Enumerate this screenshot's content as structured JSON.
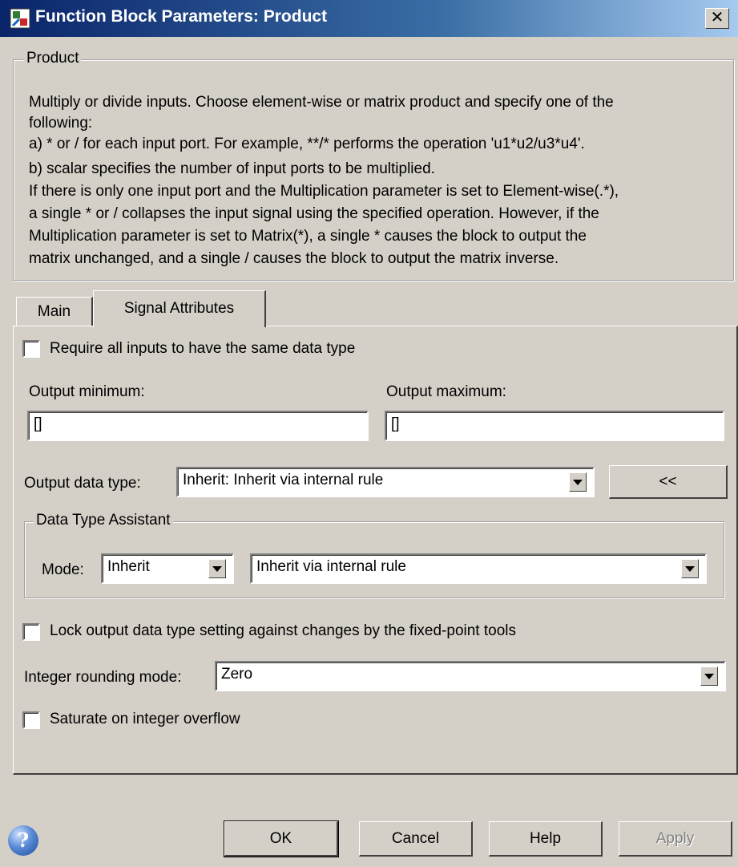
{
  "window": {
    "title": "Function Block Parameters: Product",
    "close_label": "✕"
  },
  "description": {
    "group_title": "Product",
    "lines": [
      "Multiply or divide inputs.  Choose element-wise or matrix product and specify one of the",
      "following:",
      " a) * or / for each input port. For example, **/* performs the operation 'u1*u2/u3*u4'.",
      " b) scalar specifies the number of input ports to be multiplied.",
      "If there is only one input port and the Multiplication parameter is set to Element-wise(.*),",
      "a single * or / collapses the input signal using the specified operation. However, if the",
      "Multiplication parameter is set to Matrix(*), a single * causes the block to output the",
      "matrix unchanged, and a single / causes the block to output the matrix inverse."
    ]
  },
  "tabs": [
    {
      "label": "Main",
      "active": false
    },
    {
      "label": "Signal Attributes",
      "active": true
    }
  ],
  "signal_attributes": {
    "require_same_type": {
      "label": "Require all inputs to have the same data type",
      "checked": false
    },
    "output_minimum": {
      "label": "Output minimum:",
      "value": "[]"
    },
    "output_maximum": {
      "label": "Output maximum:",
      "value": "[]"
    },
    "output_data_type": {
      "label": "Output data type:",
      "value": "Inherit: Inherit via internal rule",
      "toggle_label": "<<"
    },
    "assistant": {
      "group_title": "Data Type Assistant",
      "mode_label": "Mode:",
      "mode_value": "Inherit",
      "rule_value": "Inherit via internal rule"
    },
    "lock_output": {
      "label": "Lock output data type setting against changes by the fixed-point tools",
      "checked": false
    },
    "rounding": {
      "label": "Integer rounding mode:",
      "value": "Zero"
    },
    "saturate": {
      "label": "Saturate on integer overflow",
      "checked": false
    }
  },
  "footer": {
    "help_icon_glyph": "?",
    "ok": "OK",
    "cancel": "Cancel",
    "help": "Help",
    "apply": "Apply"
  },
  "colors": {
    "dialog_bg": "#d4d0c8",
    "titlebar_start": "#0a246a",
    "titlebar_end": "#a6caf0"
  }
}
